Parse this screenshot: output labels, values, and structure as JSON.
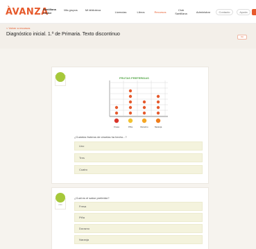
{
  "header": {
    "logo": "ÀVANZA",
    "logo_sub": "Santillana Lector",
    "nav": [
      {
        "label": "Mis grupos",
        "active": false
      },
      {
        "label": "Mi biblioteca",
        "active": false
      },
      {
        "label": "Licencias",
        "active": false
      },
      {
        "label": "Libros",
        "active": false
      },
      {
        "label": "Recursos",
        "active": true
      },
      {
        "label": "Club Santillana",
        "active": false
      },
      {
        "label": "Administrar",
        "active": false
      }
    ],
    "contact_label": "Contacto",
    "help_label": "Ayuda"
  },
  "page": {
    "breadcrumb": "< Volver a recursos",
    "title": "Diagnóstico inicial. 1.º de Primaria. Texto discontinuo",
    "header_button": "Ver"
  },
  "questions": [
    {
      "number_label": "1/11",
      "chart_title": "FRUTAS PREFERIDAS",
      "prompt": "¿Cuántos fruteros de ciruelas ha hecho...?",
      "options": [
        "Uno",
        "Tres",
        "Cuatro"
      ]
    },
    {
      "number_label": "2/11",
      "prompt": "¿Cuál es el sabor preferido?",
      "options": [
        "Fresa",
        "Piña",
        "Durazno",
        "Naranja"
      ]
    }
  ],
  "chart_data": {
    "type": "scatter",
    "title": "FRUTAS PREFERIDAS",
    "categories": [
      "Fresa",
      "Piña",
      "Durazno",
      "Naranja"
    ],
    "values": [
      2,
      5,
      3,
      4
    ],
    "ylim": [
      0,
      6
    ],
    "grid": true
  },
  "colors": {
    "accent": "#e65a2c",
    "bead": "#e65a2c",
    "chart_title": "#55a648",
    "question_badge": "#a6c83a"
  }
}
